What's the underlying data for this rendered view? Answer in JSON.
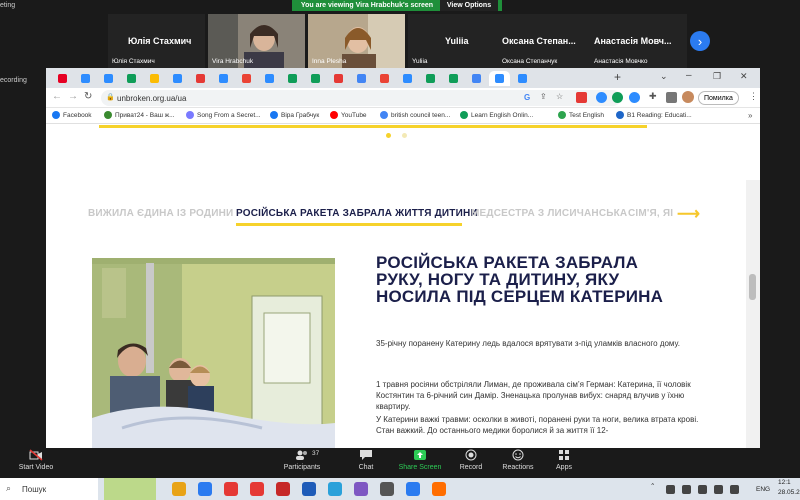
{
  "zoom": {
    "meeting_title_fragment": "eting",
    "recording_fragment": "ecording",
    "share_banner": "You are viewing Vira Hrabchuk's screen",
    "view_options": "View Options",
    "participants": [
      {
        "big": "Юлія Стахмич",
        "small": "Юлія Стахмич"
      },
      {
        "big": "",
        "small": "Vira Hrabchuk"
      },
      {
        "big": "",
        "small": "Inna Plesha"
      },
      {
        "big": "Yuliia",
        "small": "Yuliia"
      },
      {
        "big": "Оксана Степан...",
        "small": "Оксана Степанчук"
      },
      {
        "big": "Анастасія Мовч...",
        "small": "Анастасія Мовчко"
      }
    ],
    "controls": {
      "start_video": "Start Video",
      "participants": "Participants",
      "participants_count": "37",
      "chat": "Chat",
      "share_screen": "Share Screen",
      "record": "Record",
      "reactions": "Reactions",
      "apps": "Apps"
    }
  },
  "browser": {
    "url": "unbroken.org.ua/ua",
    "error_button": "Помилка",
    "bookmarks": [
      {
        "label": "Facebook",
        "color": "#1877f2"
      },
      {
        "label": "Приват24 - Ваш ж...",
        "color": "#3a8a2f"
      },
      {
        "label": "Song From a Secret...",
        "color": "#7a7aff"
      },
      {
        "label": "Віра Грабчук",
        "color": "#1877f2"
      },
      {
        "label": "YouTube",
        "color": "#ff0000"
      },
      {
        "label": "british council teen...",
        "color": "#4285f4"
      },
      {
        "label": "Learn English Onlin...",
        "color": "#0f9d58"
      },
      {
        "label": "Test English",
        "color": "#2da44e"
      },
      {
        "label": "B1 Reading: Educati...",
        "color": "#1e66c8"
      }
    ],
    "tab_colors": [
      "#e60023",
      "#2d8cff",
      "#2d8cff",
      "#0f9d58",
      "#fbbc04",
      "#2d8cff",
      "#e53935",
      "#2d8cff",
      "#ea4335",
      "#2d8cff",
      "#0f9d58",
      "#0f9d58",
      "#e53935",
      "#4285f4",
      "#ea4335",
      "#2d8cff",
      "#0f9d58",
      "#0f9d58",
      "#4285f4",
      "#2d8cff",
      "#2d8cff"
    ]
  },
  "page": {
    "stories": [
      "ВИЖИЛА ЄДИНА ІЗ РОДИНИ",
      "РОСІЙСЬКА РАКЕТА ЗАБРАЛА ЖИТТЯ ДИТИНИ",
      "МЕДСЕСТРА З ЛИСИЧАНСЬКА",
      "СІМ'Я, ЯІ"
    ],
    "headline": "РОСІЙСЬКА РАКЕТА ЗАБРАЛА РУКУ, НОГУ ТА ДИТИНУ, ЯКУ НОСИЛА ПІД СЕРЦЕМ КАТЕРИНА",
    "para1": "35-річну поранену Катерину ледь вдалося врятувати з-під уламків власного дому.",
    "para2": "1 травня росіяни обстріляли Лиман, де проживала сім’я Герман: Катерина, її чоловік Костянтин та 6-річний син Дамір. Зненацька пролунав вибух: снаряд влучив у їхню квартиру.",
    "para3": "У Катерини важкі травми: осколки в животі, поранені руки та ноги, велика втрата крові. Стан важкий. До останнього медики боролися й за життя її 12-"
  },
  "taskbar": {
    "search": "Пошук",
    "lang": "ENG",
    "time": "12:1",
    "date": "28.05.2",
    "icon_colors": [
      "#e8a317",
      "#2b7bf0",
      "#e53935",
      "#e53935",
      "#c62828",
      "#1e5bb8",
      "#2aa1da",
      "#7e57c2",
      "#555",
      "#2b7bf0",
      "#ff6d00"
    ]
  }
}
